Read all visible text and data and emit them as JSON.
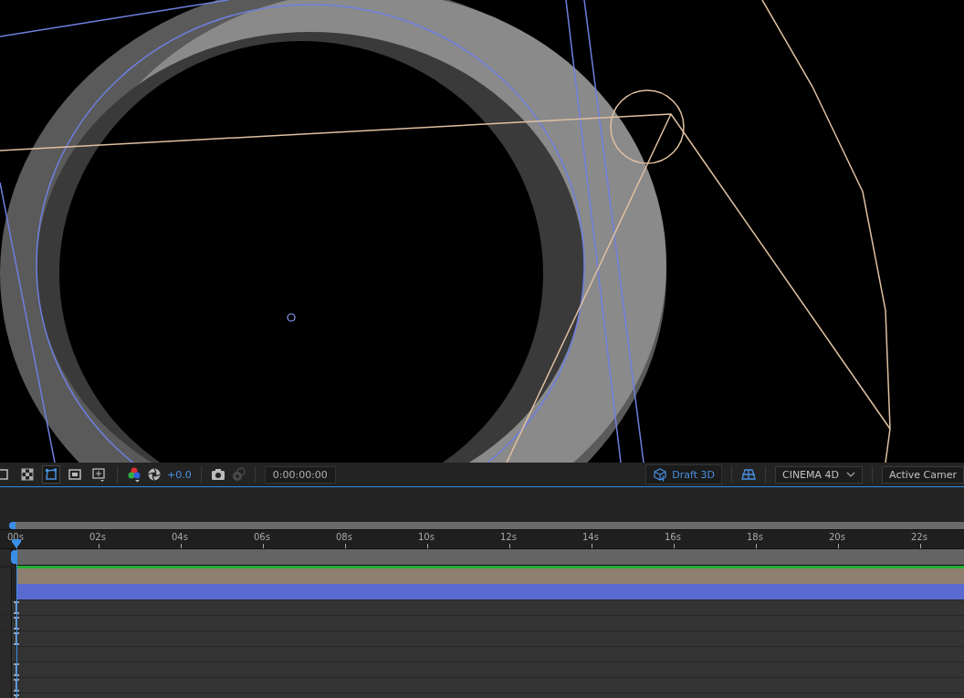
{
  "toolbar": {
    "view_toggles": [
      {
        "selected": false
      },
      {
        "selected": false
      },
      {
        "selected": true
      },
      {
        "selected": false
      },
      {
        "selected": false
      }
    ],
    "exposure": "+0.0",
    "snapshot": {
      "disabled": true
    },
    "timecode": "0:00:00:00",
    "draft_3d": {
      "label": "Draft 3D",
      "on": true
    },
    "renderer": "CINEMA 4D",
    "view": "Active Camer"
  },
  "timeline": {
    "ticks": [
      "00s",
      "02s",
      "04s",
      "06s",
      "08s",
      "10s",
      "12s",
      "14s",
      "16s",
      "18s",
      "20s",
      "22s"
    ],
    "layer_bars": [
      {
        "color": "#646464"
      },
      {
        "color": "#8f7f70"
      },
      {
        "color": "#5a6ad0"
      }
    ],
    "rows": [
      {
        "keyframe": true
      },
      {
        "keyframe": true
      },
      {
        "keyframe": true
      },
      {
        "keyframe": false
      },
      {
        "keyframe": true
      },
      {
        "keyframe": true
      },
      {
        "keyframe": true
      }
    ]
  }
}
